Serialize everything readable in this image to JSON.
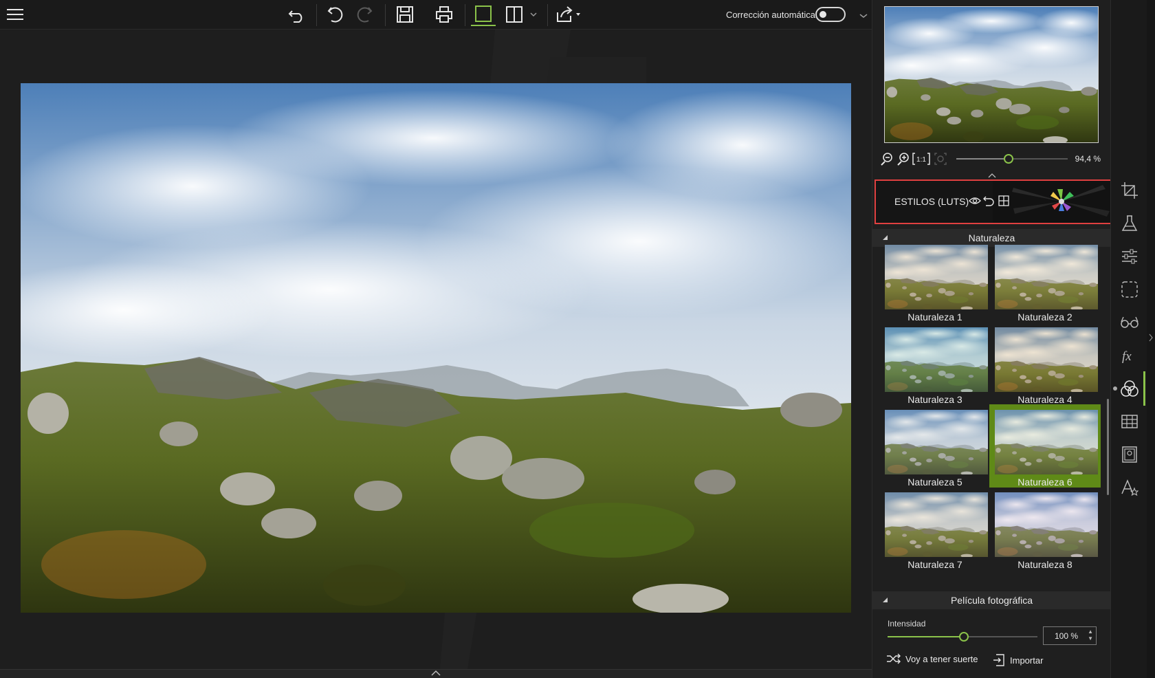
{
  "toolbar": {
    "auto_correction_label": "Corrección automática",
    "auto_correction_on": false,
    "buttons": [
      "menu-icon",
      "undo-all-icon",
      "undo-icon",
      "redo-icon",
      "save-icon",
      "print-icon",
      "single-view-icon",
      "split-view-icon",
      "dropdown-icon",
      "share-icon"
    ]
  },
  "navigator": {
    "zoom_value": "94,4 %",
    "zoom_fraction": 0.47,
    "zoom_one_to_one": "1:1"
  },
  "styles": {
    "title": "ESTILOS (LUTS)"
  },
  "sections": {
    "nature": "Naturaleza",
    "film": "Película fotográfica"
  },
  "presets": [
    {
      "label": "Naturaleza 1",
      "tint": "#c8a66a",
      "selected": false
    },
    {
      "label": "Naturaleza 2",
      "tint": "#d4b47a",
      "selected": false
    },
    {
      "label": "Naturaleza 3",
      "tint": "#7fb8a8",
      "selected": false
    },
    {
      "label": "Naturaleza 4",
      "tint": "#c8a060",
      "selected": false
    },
    {
      "label": "Naturaleza 5",
      "tint": "#a8b4b8",
      "selected": false
    },
    {
      "label": "Naturaleza 6",
      "tint": "#b8c090",
      "selected": true
    },
    {
      "label": "Naturaleza 7",
      "tint": "#c0a880",
      "selected": false
    },
    {
      "label": "Naturaleza 8",
      "tint": "#c8b0c8",
      "selected": false
    }
  ],
  "intensity": {
    "label": "Intensidad",
    "value": "100 %"
  },
  "actions": {
    "lucky": "Voy a tener suerte",
    "import": "Importar"
  },
  "colors": {
    "accent": "#8bc34a",
    "highlight_border": "#e04040",
    "selected_tile": "#5f8a17"
  }
}
